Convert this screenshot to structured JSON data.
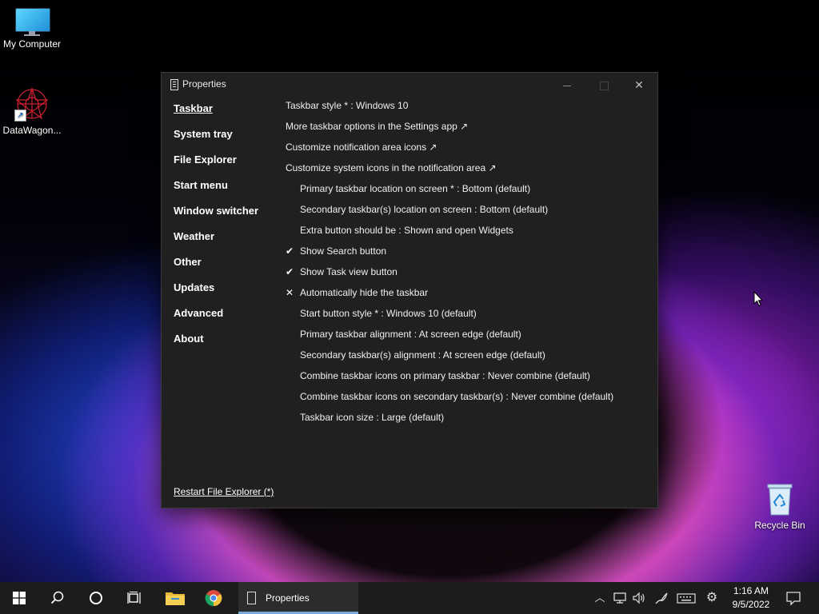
{
  "desktop": {
    "icons": [
      {
        "label": "My Computer"
      },
      {
        "label": "DataWagon..."
      },
      {
        "label": "Recycle Bin"
      }
    ]
  },
  "window": {
    "title": "Properties",
    "nav": [
      {
        "label": "Taskbar",
        "active": true
      },
      {
        "label": "System tray"
      },
      {
        "label": "File Explorer"
      },
      {
        "label": "Start menu"
      },
      {
        "label": "Window switcher"
      },
      {
        "label": "Weather"
      },
      {
        "label": "Other"
      },
      {
        "label": "Updates"
      },
      {
        "label": "Advanced"
      },
      {
        "label": "About"
      }
    ],
    "settings": [
      {
        "text": "Taskbar style * : Windows 10",
        "mark": "",
        "indent": false
      },
      {
        "text": "More taskbar options in the Settings app ↗",
        "mark": "",
        "indent": false
      },
      {
        "text": "Customize notification area icons ↗",
        "mark": "",
        "indent": false
      },
      {
        "text": "Customize system icons in the notification area ↗",
        "mark": "",
        "indent": false
      },
      {
        "text": "Primary taskbar location on screen * : Bottom (default)",
        "mark": "",
        "indent": true
      },
      {
        "text": "Secondary taskbar(s) location on screen : Bottom (default)",
        "mark": "",
        "indent": true
      },
      {
        "text": "Extra button should be : Shown and open Widgets",
        "mark": "",
        "indent": true
      },
      {
        "text": "Show Search button",
        "mark": "✔",
        "indent": true
      },
      {
        "text": "Show Task view button",
        "mark": "✔",
        "indent": true
      },
      {
        "text": "Automatically hide the taskbar",
        "mark": "✕",
        "indent": true
      },
      {
        "text": "Start button style * : Windows 10 (default)",
        "mark": "",
        "indent": true
      },
      {
        "text": "Primary taskbar alignment : At screen edge (default)",
        "mark": "",
        "indent": true
      },
      {
        "text": "Secondary taskbar(s) alignment : At screen edge (default)",
        "mark": "",
        "indent": true
      },
      {
        "text": "Combine taskbar icons on primary taskbar : Never combine (default)",
        "mark": "",
        "indent": true
      },
      {
        "text": "Combine taskbar icons on secondary taskbar(s) : Never combine (default)",
        "mark": "",
        "indent": true
      },
      {
        "text": "Taskbar icon size : Large (default)",
        "mark": "",
        "indent": true
      }
    ],
    "restart_link": "Restart File Explorer (*)"
  },
  "taskbar": {
    "running_app_label": "Properties",
    "clock": {
      "time": "1:16 AM",
      "date": "9/5/2022"
    },
    "accent": "#7aa8d8"
  }
}
